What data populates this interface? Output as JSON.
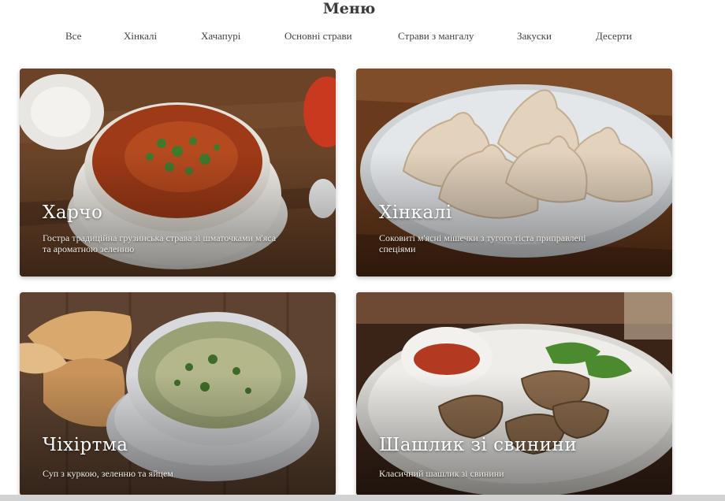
{
  "page": {
    "title": "Меню"
  },
  "tabs": [
    {
      "label": "Все"
    },
    {
      "label": "Хінкалі"
    },
    {
      "label": "Хачапурі"
    },
    {
      "label": "Основні страви"
    },
    {
      "label": "Страви з мангалу"
    },
    {
      "label": "Закуски"
    },
    {
      "label": "Десерти"
    }
  ],
  "cards": [
    {
      "title": "Харчо",
      "description": "Гостра традиційна грузинська страва зі шматочками м'яса та ароматною зеленню",
      "image": "kharcho-soup-photo"
    },
    {
      "title": "Хінкалі",
      "description": "Соковиті м'ясні мішечки з тугого тіста приправлені спеціями",
      "image": "khinkali-photo"
    },
    {
      "title": "Чіхіртма",
      "description": "Суп з куркою, зеленню та яйцем",
      "image": "chikhirtma-soup-photo"
    },
    {
      "title": "Шашлик зі свинини",
      "description": "Класичний шашлик зі свинини",
      "image": "pork-shashlik-photo"
    }
  ]
}
